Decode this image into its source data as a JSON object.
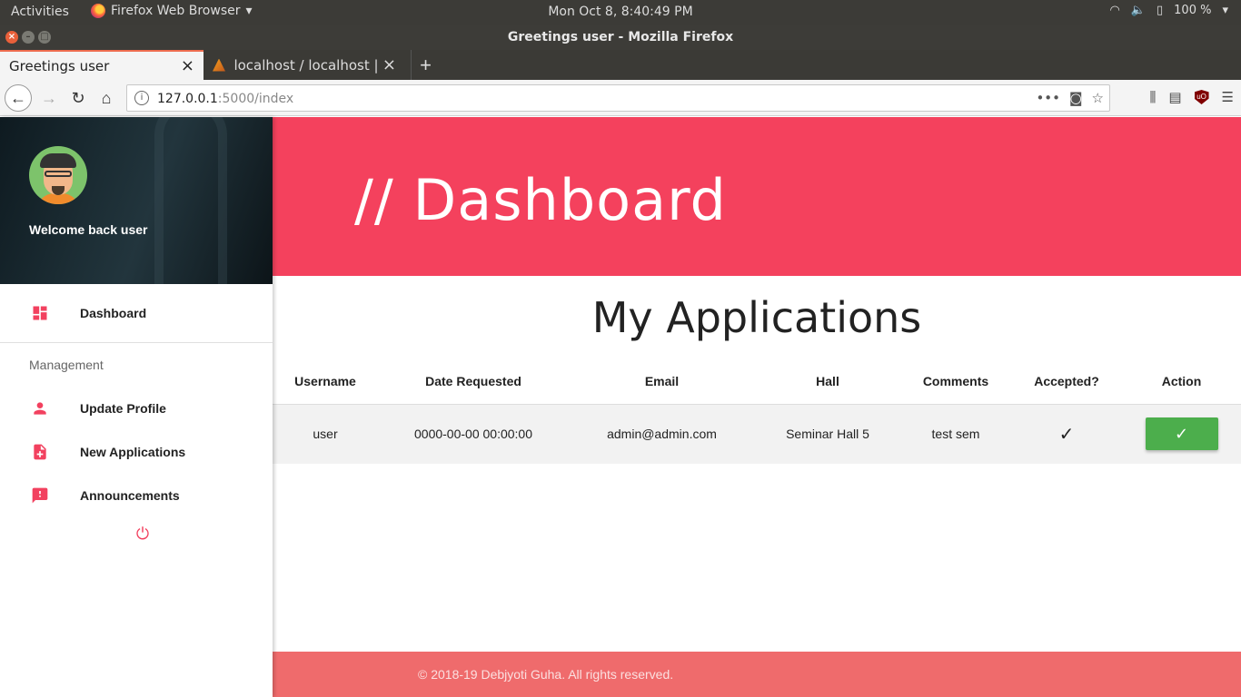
{
  "desktop": {
    "activities": "Activities",
    "app_menu": "Firefox Web Browser",
    "clock": "Mon Oct  8,  8:40:49 PM",
    "battery": "100 %"
  },
  "window": {
    "title": "Greetings user - Mozilla Firefox"
  },
  "tabs": [
    {
      "label": "Greetings user"
    },
    {
      "label": "localhost / localhost | phpMyAdmin"
    }
  ],
  "address": {
    "host": "127.0.0.1",
    "rest": ":5000/index"
  },
  "sidebar": {
    "welcome": "Welcome back user",
    "items": [
      {
        "label": "Dashboard",
        "icon": "dashboard-icon"
      },
      {
        "label": "Update Profile",
        "icon": "person-icon"
      },
      {
        "label": "New Applications",
        "icon": "note-add-icon"
      },
      {
        "label": "Announcements",
        "icon": "feedback-icon"
      }
    ],
    "section": "Management"
  },
  "banner": {
    "title": "// Dashboard"
  },
  "applications": {
    "title": "My Applications",
    "columns": [
      "Username",
      "Date Requested",
      "Email",
      "Hall",
      "Comments",
      "Accepted?",
      "Action"
    ],
    "rows": [
      {
        "username": "user",
        "date": "0000-00-00 00:00:00",
        "email": "admin@admin.com",
        "hall": "Seminar Hall 5",
        "comments": "test sem",
        "accepted": "✓",
        "action": "✓"
      }
    ]
  },
  "footer": {
    "copyright": "© 2018-19 Debjyoti Guha. All rights reserved."
  },
  "colors": {
    "accent": "#f4415d",
    "footer": "#ef6b6c",
    "action_button": "#4cae4c"
  }
}
